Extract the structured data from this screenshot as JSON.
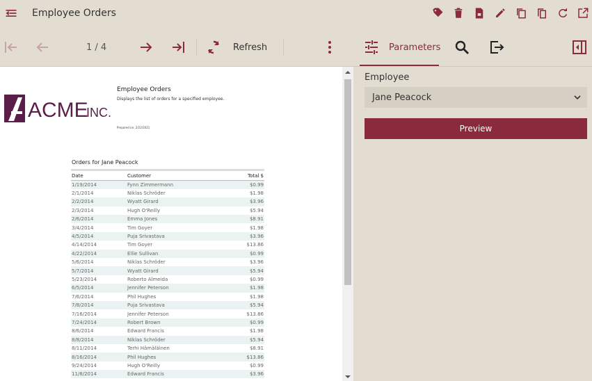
{
  "titlebar": {
    "title": "Employee Orders",
    "icons": [
      "back-arrow-icon",
      "tag-icon",
      "delete-icon",
      "export-file-icon",
      "edit-icon",
      "duplicate-icon",
      "copy-icon",
      "reload-icon",
      "open-external-icon"
    ]
  },
  "navbar": {
    "page_info": "1 / 4",
    "refresh_label": "Refresh",
    "parameters_label": "Parameters"
  },
  "report": {
    "logo_text": "ACME INC.",
    "title": "Employee Orders",
    "description": "Displays the list of orders for a specified employee.",
    "prepared": "Prepared on: 2/22/2021",
    "orders_heading": "Orders for Jane Peacock",
    "columns": [
      "Date",
      "Customer",
      "Total $"
    ],
    "rows": [
      [
        "1/19/2014",
        "Fynn Zimmermann",
        "$0.99"
      ],
      [
        "2/1/2014",
        "Niklas Schröder",
        "$1.98"
      ],
      [
        "2/2/2014",
        "Wyatt Girard",
        "$3.96"
      ],
      [
        "2/3/2014",
        "Hugh O'Reilly",
        "$5.94"
      ],
      [
        "2/6/2014",
        "Emma Jones",
        "$8.91"
      ],
      [
        "3/4/2014",
        "Tim Goyer",
        "$1.98"
      ],
      [
        "4/5/2014",
        "Puja Srivastava",
        "$3.96"
      ],
      [
        "4/14/2014",
        "Tim Goyer",
        "$13.86"
      ],
      [
        "4/22/2014",
        "Ellie Sullivan",
        "$0.99"
      ],
      [
        "5/6/2014",
        "Niklas Schröder",
        "$3.96"
      ],
      [
        "5/7/2014",
        "Wyatt Girard",
        "$5.94"
      ],
      [
        "5/23/2014",
        "Roberto Almeida",
        "$0.99"
      ],
      [
        "6/5/2014",
        "Jennifer Peterson",
        "$1.98"
      ],
      [
        "7/6/2014",
        "Phil Hughes",
        "$1.98"
      ],
      [
        "7/8/2014",
        "Puja Srivastava",
        "$5.94"
      ],
      [
        "7/16/2014",
        "Jennifer Peterson",
        "$13.86"
      ],
      [
        "7/24/2014",
        "Robert Brown",
        "$0.99"
      ],
      [
        "8/6/2014",
        "Edward Francis",
        "$1.98"
      ],
      [
        "8/8/2014",
        "Niklas Schröder",
        "$5.94"
      ],
      [
        "8/11/2014",
        "Terhi Hämäläinen",
        "$8.91"
      ],
      [
        "8/16/2014",
        "Phil Hughes",
        "$13.86"
      ],
      [
        "9/24/2014",
        "Hugh O'Reilly",
        "$0.99"
      ],
      [
        "11/8/2014",
        "Edward Francis",
        "$3.96"
      ]
    ]
  },
  "parameters": {
    "employee_label": "Employee",
    "employee_value": "Jane Peacock",
    "preview_label": "Preview"
  },
  "colors": {
    "accent": "#8b2a3c",
    "background": "#e2ddd0",
    "select_bg": "#d5d0c3",
    "disabled": "#c9a3ab"
  }
}
